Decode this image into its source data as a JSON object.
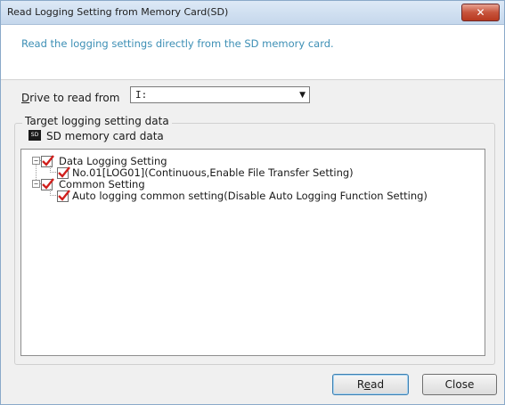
{
  "window": {
    "title": "Read Logging Setting from Memory Card(SD)",
    "close_glyph": "✕"
  },
  "header": {
    "description": "Read the logging settings directly from the SD memory card."
  },
  "drive": {
    "label": "Drive to read from",
    "value": "I:"
  },
  "target": {
    "group_label": "Target logging setting data",
    "root_label": "SD memory card data",
    "root_icon_text": "SD",
    "tree": [
      {
        "label": "Data Logging Setting",
        "expanded": true,
        "checked": true,
        "children": [
          {
            "label": "No.01[LOG01](Continuous,Enable File Transfer Setting)",
            "checked": true
          }
        ]
      },
      {
        "label": "Common Setting",
        "expanded": true,
        "checked": true,
        "children": [
          {
            "label": "Auto logging common setting(Disable Auto Logging Function Setting)",
            "checked": true
          }
        ]
      }
    ]
  },
  "buttons": {
    "read_label": "Read",
    "close_label": "Close"
  },
  "colors": {
    "header_text": "#3d8fb5",
    "check_mark": "#d0201d",
    "title_close_bg": "#c7543c"
  },
  "icons": {
    "expander": "minus-box-icon",
    "check": "checkmark-icon",
    "dropdown": "chevron-down-icon",
    "root": "sd-card-icon"
  }
}
